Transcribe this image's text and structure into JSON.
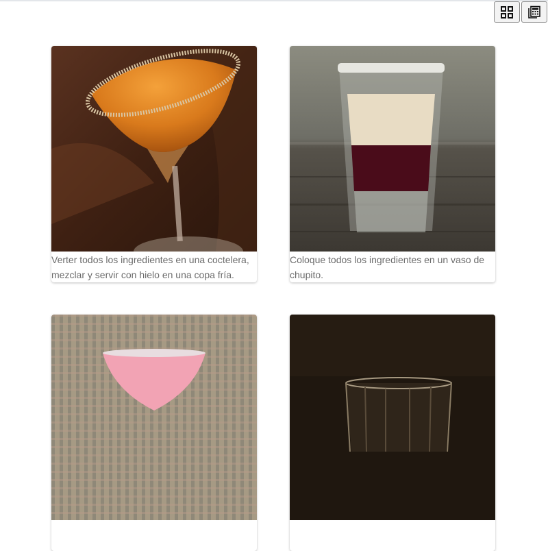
{
  "toolbar": {
    "grid_view_icon": "grid-view-icon",
    "calculator_icon": "calculator-icon"
  },
  "cards": [
    {
      "image": "orange-martini-sugar-rim",
      "caption": "Verter todos los ingredientes en una coctelera, mezclar y servir con hielo en una copa fría."
    },
    {
      "image": "layered-shot-glass-cream-red",
      "caption": "Coloque todos los ingredientes en un vaso de chupito."
    },
    {
      "image": "pink-martini-glass",
      "caption": ""
    },
    {
      "image": "dark-shot-glass",
      "caption": ""
    }
  ]
}
